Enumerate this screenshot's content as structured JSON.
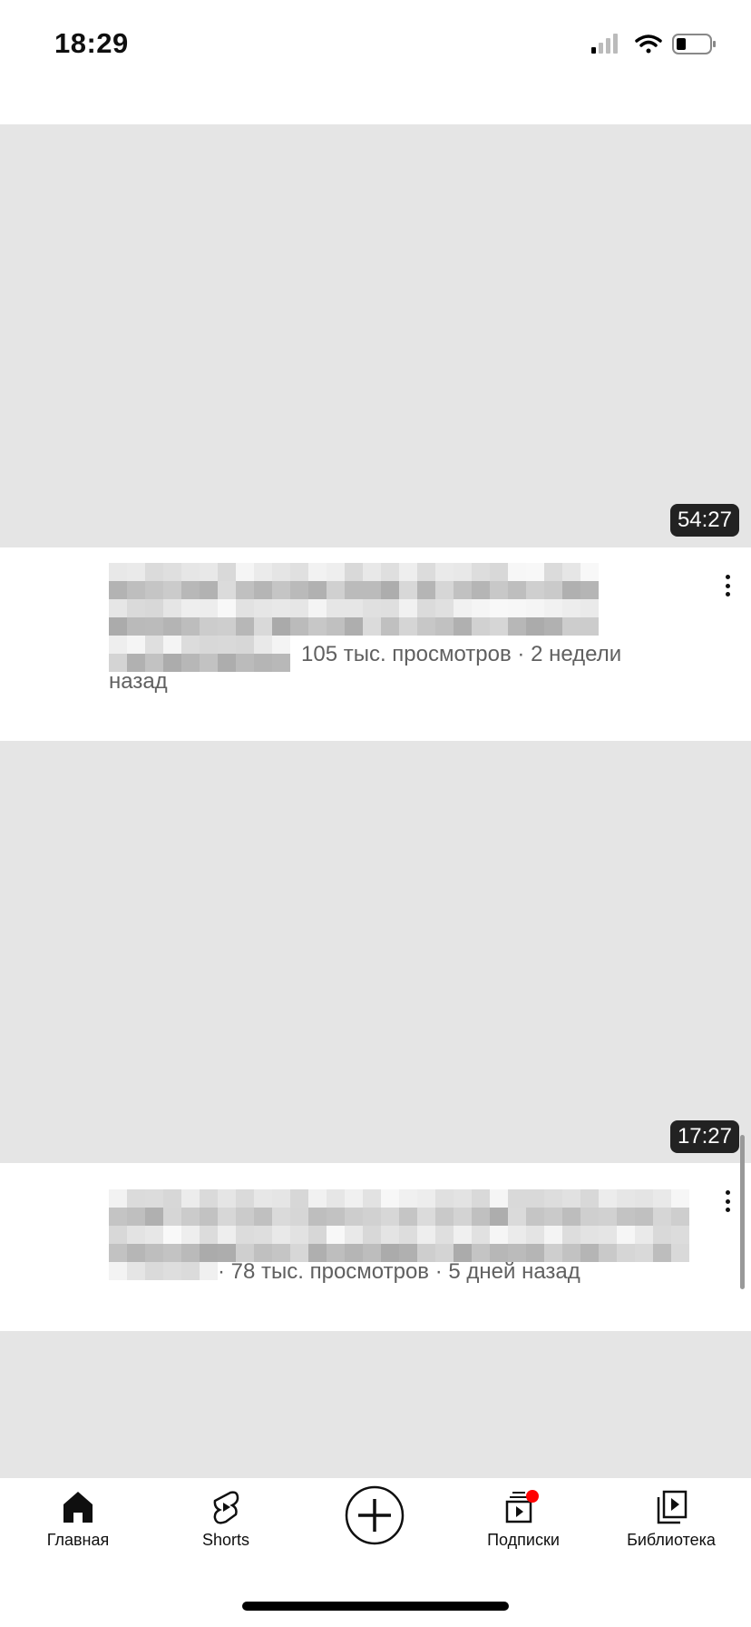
{
  "status_bar": {
    "time": "18:29",
    "signal_bars": 1,
    "battery_level": 0.2
  },
  "videos": [
    {
      "duration": "54:27",
      "meta_visible": "105 тыс. просмотров · 2 недели",
      "meta_wrap": "назад"
    },
    {
      "duration": "17:27",
      "meta_visible": "· 78 тыс. просмотров · 5 дней назад"
    }
  ],
  "nav": {
    "items": [
      {
        "label": "Главная",
        "icon": "home-icon"
      },
      {
        "label": "Shorts",
        "icon": "shorts-icon"
      },
      {
        "label": "",
        "icon": "create-plus-icon"
      },
      {
        "label": "Подписки",
        "icon": "subscriptions-icon",
        "notification_color": "#ff0000"
      },
      {
        "label": "Библиотека",
        "icon": "library-icon"
      }
    ]
  }
}
